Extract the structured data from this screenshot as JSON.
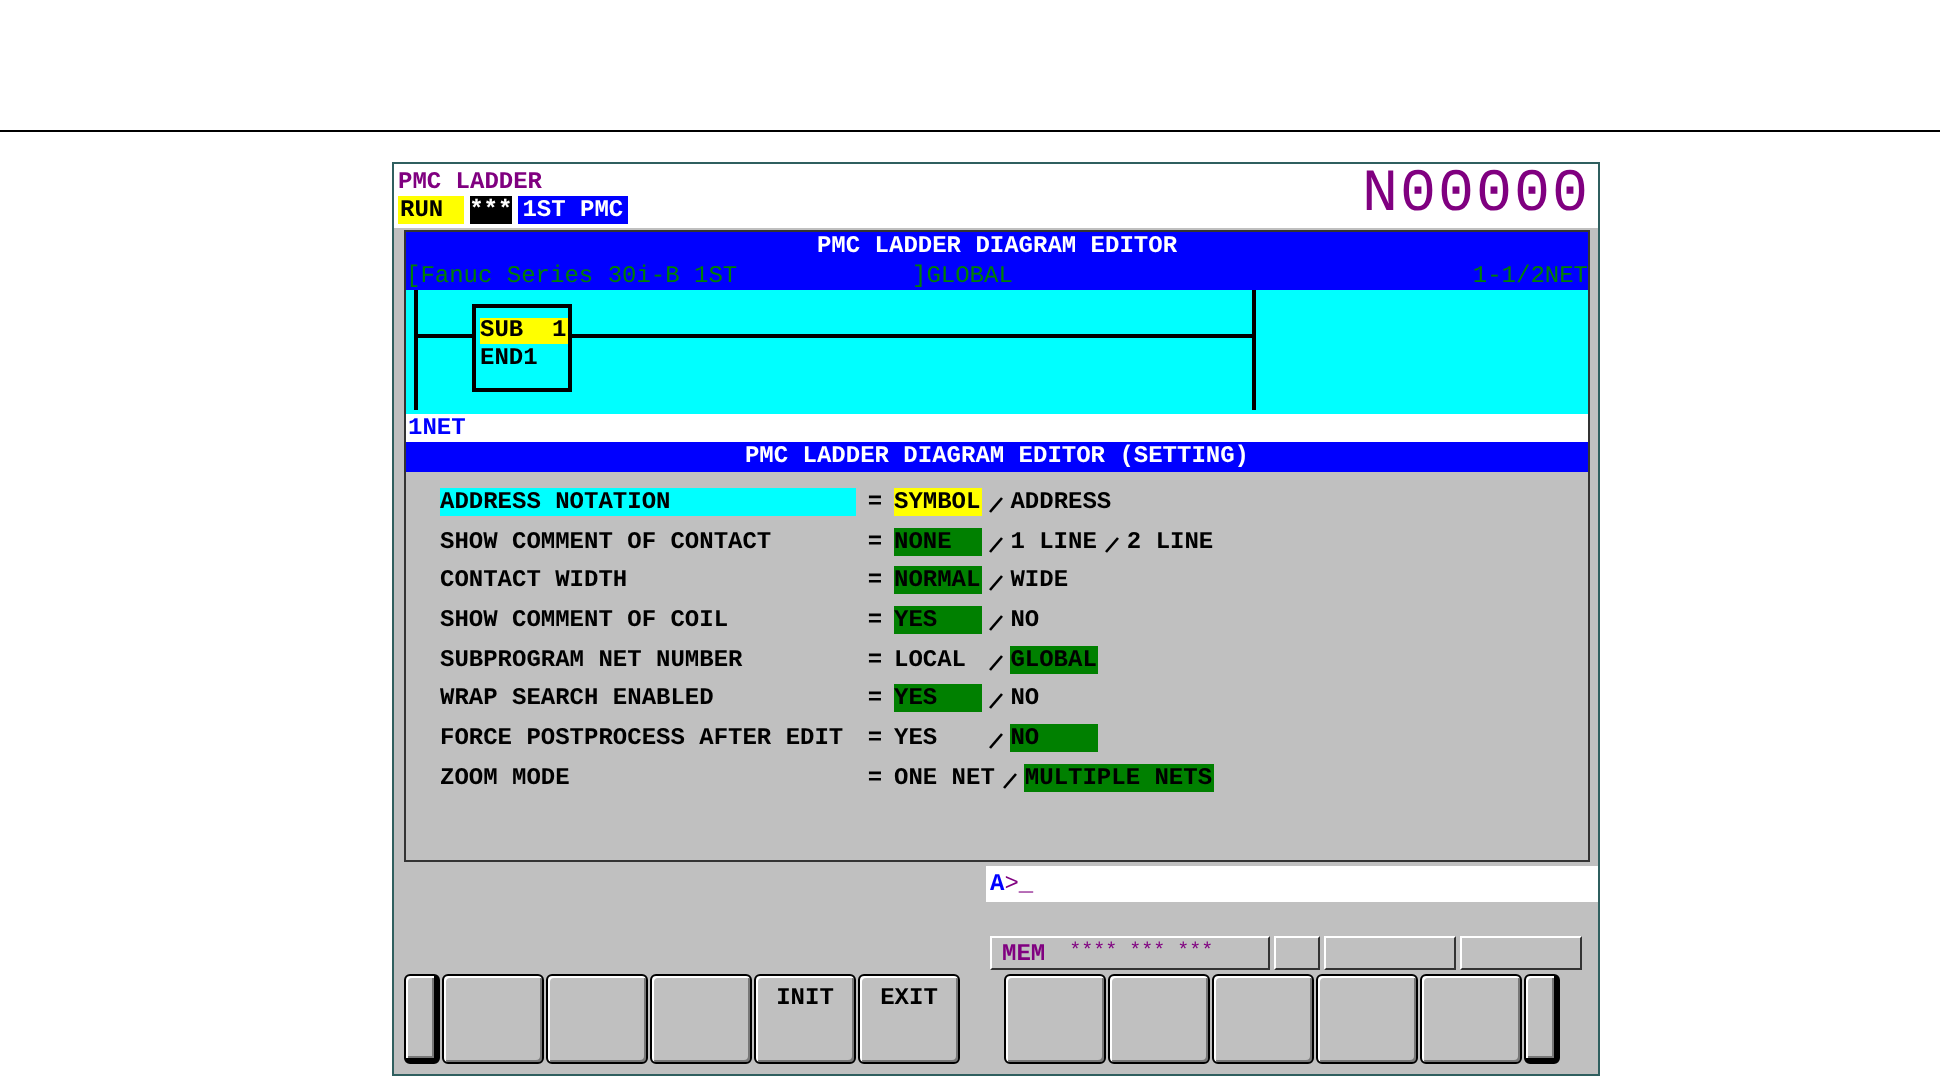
{
  "header": {
    "title": "PMC LADDER",
    "mode": "RUN",
    "alarm": "***",
    "pmc": "1ST PMC",
    "program_number": "N00000"
  },
  "editor": {
    "title": "PMC LADDER DIAGRAM EDITOR",
    "info_left": "[Fanuc Series 30i-B 1ST",
    "info_mid": "]GLOBAL",
    "info_right": "1-1/2NET",
    "ladder": {
      "function": "SUB  1",
      "name": "END1"
    },
    "net_label": "1NET"
  },
  "settings": {
    "title": "PMC LADDER DIAGRAM EDITOR (SETTING)",
    "rows": [
      {
        "label": "ADDRESS NOTATION",
        "cursor": true,
        "sign": "=",
        "options": [
          {
            "text": "SYMBOL",
            "selected": true
          },
          {
            "text": "ADDRESS",
            "selected": false
          }
        ]
      },
      {
        "label": "SHOW COMMENT OF CONTACT",
        "cursor": false,
        "sign": "=",
        "options": [
          {
            "text": "NONE",
            "selected": true
          },
          {
            "text": "1 LINE",
            "selected": false
          },
          {
            "text": "2 LINE",
            "selected": false
          }
        ]
      },
      {
        "label": "CONTACT WIDTH",
        "cursor": false,
        "sign": "=",
        "options": [
          {
            "text": "NORMAL",
            "selected": true
          },
          {
            "text": "WIDE",
            "selected": false
          }
        ]
      },
      {
        "label": "SHOW COMMENT OF COIL",
        "cursor": false,
        "sign": "=",
        "options": [
          {
            "text": "YES",
            "selected": true
          },
          {
            "text": "NO",
            "selected": false
          }
        ]
      },
      {
        "label": "SUBPROGRAM NET NUMBER",
        "cursor": false,
        "sign": "=",
        "options": [
          {
            "text": "LOCAL",
            "selected": false
          },
          {
            "text": "GLOBAL",
            "selected": true
          }
        ]
      },
      {
        "label": "WRAP SEARCH ENABLED",
        "cursor": false,
        "sign": "=",
        "options": [
          {
            "text": "YES",
            "selected": true
          },
          {
            "text": "NO",
            "selected": false
          }
        ]
      },
      {
        "label": "FORCE POSTPROCESS AFTER EDIT",
        "cursor": false,
        "sign": "=",
        "options": [
          {
            "text": "YES",
            "selected": false
          },
          {
            "text": "NO",
            "selected": true
          }
        ]
      },
      {
        "label": "ZOOM MODE",
        "cursor": false,
        "sign": "=",
        "options": [
          {
            "text": "ONE NET",
            "selected": false
          },
          {
            "text": "MULTIPLE NETS",
            "selected": true
          }
        ]
      }
    ]
  },
  "command_line": {
    "prompt": "A",
    "value": ">_"
  },
  "status_bar": {
    "mode": "MEM",
    "status": "**** *** ***"
  },
  "softkeys": [
    {
      "kind": "edge"
    },
    {
      "kind": "blank"
    },
    {
      "kind": "blank"
    },
    {
      "kind": "blank"
    },
    {
      "kind": "key",
      "label": "INIT"
    },
    {
      "kind": "key",
      "label": "EXIT"
    },
    {
      "kind": "gap"
    },
    {
      "kind": "blank"
    },
    {
      "kind": "blank"
    },
    {
      "kind": "blank"
    },
    {
      "kind": "blank"
    },
    {
      "kind": "blank"
    },
    {
      "kind": "edge"
    }
  ]
}
